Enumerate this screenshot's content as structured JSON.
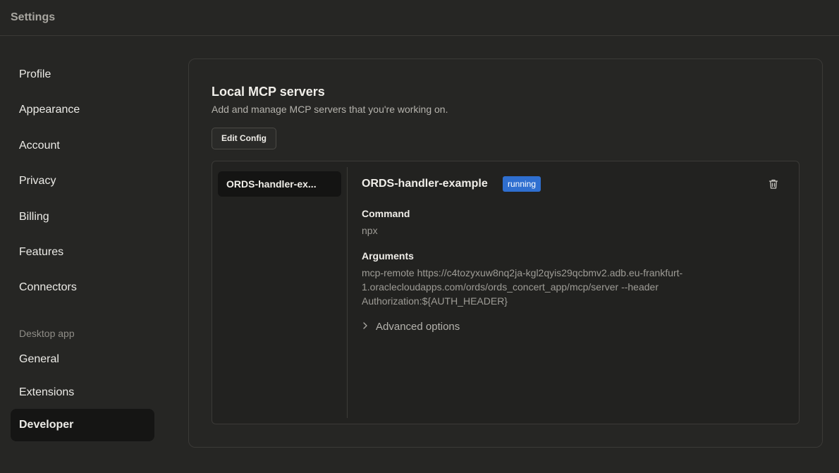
{
  "window": {
    "title": "Settings"
  },
  "sidebar": {
    "items": [
      {
        "label": "Profile"
      },
      {
        "label": "Appearance"
      },
      {
        "label": "Account"
      },
      {
        "label": "Privacy"
      },
      {
        "label": "Billing"
      },
      {
        "label": "Features"
      },
      {
        "label": "Connectors"
      }
    ],
    "section_label": "Desktop app",
    "desktop_items": [
      {
        "label": "General"
      },
      {
        "label": "Extensions"
      },
      {
        "label": "Developer",
        "active": true
      }
    ]
  },
  "panel": {
    "title": "Local MCP servers",
    "subtitle": "Add and manage MCP servers that you're working on.",
    "edit_config_label": "Edit Config"
  },
  "servers": {
    "list": [
      {
        "label": "ORDS-handler-ex..."
      }
    ],
    "selected": {
      "name": "ORDS-handler-example",
      "status": "running",
      "status_color": "#2f6fd0",
      "delete_icon": "trash-icon",
      "command_label": "Command",
      "command": "npx",
      "arguments_label": "Arguments",
      "arguments_lines": [
        "mcp-remote https://c4tozyxuw8nq2ja-kgl2qyis29qcbmv2.adb.eu-frankfurt-",
        "1.oraclecloudapps.com/ords/ords_concert_app/mcp/server --header",
        "Authorization:${AUTH_HEADER}"
      ],
      "advanced_label": "Advanced options",
      "advanced_icon": "chevron-right-icon"
    }
  }
}
